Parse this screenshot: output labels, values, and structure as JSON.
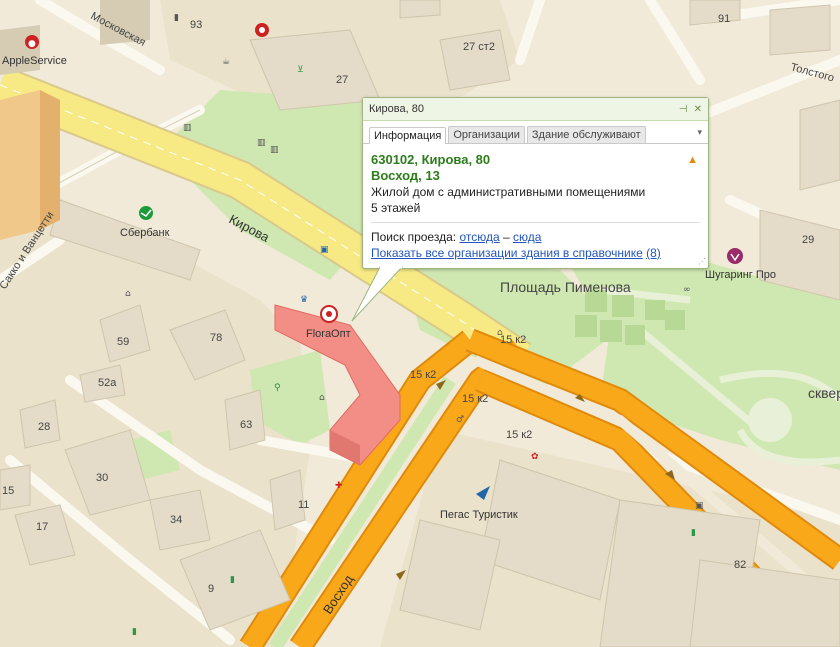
{
  "map": {
    "streets": [
      "Московская",
      "Кирова",
      "Восход",
      "Толстого",
      "Сакко и Ванцетти"
    ],
    "places": [
      "Площадь Пименова",
      "сквер"
    ],
    "pois": [
      "AppleService",
      "Сбербанк",
      "FloraОпт",
      "Шугаринг Про",
      "Пегас Туристик"
    ],
    "house_numbers": {
      "n93": "93",
      "n27st2": "27 ст2",
      "n27": "27",
      "n91": "91",
      "n29": "29",
      "n59": "59",
      "n52a": "52а",
      "n78": "78",
      "n28": "28",
      "n30": "30",
      "n63": "63",
      "n15": "15",
      "n17": "17",
      "n34": "34",
      "n11": "11",
      "n9": "9",
      "n15k2a": "15 к2",
      "n15k2b": "15 к2",
      "n15k2c": "15 к2",
      "n15k2d": "15 к2",
      "n82": "82"
    },
    "colors": {
      "arterial": "#f9a81a",
      "main_road": "#f7e983",
      "park": "#cfe7b0",
      "highlight": "#f38e86"
    }
  },
  "popup": {
    "title": "Кирова, 80",
    "tabs": [
      "Информация",
      "Организации",
      "Здание обслуживают"
    ],
    "active_tab": "Информация",
    "address": "630102, Кирова, 80",
    "alt_address": "Восход, 13",
    "description": "Жилой дом с административными помещениями",
    "floors": "5 этажей",
    "route_label": "Поиск проезда:",
    "route_from": "отсюда",
    "route_dash": "–",
    "route_to": "сюда",
    "show_all_link": "Показать все организации здания в справочнике",
    "org_count": "(8)"
  }
}
